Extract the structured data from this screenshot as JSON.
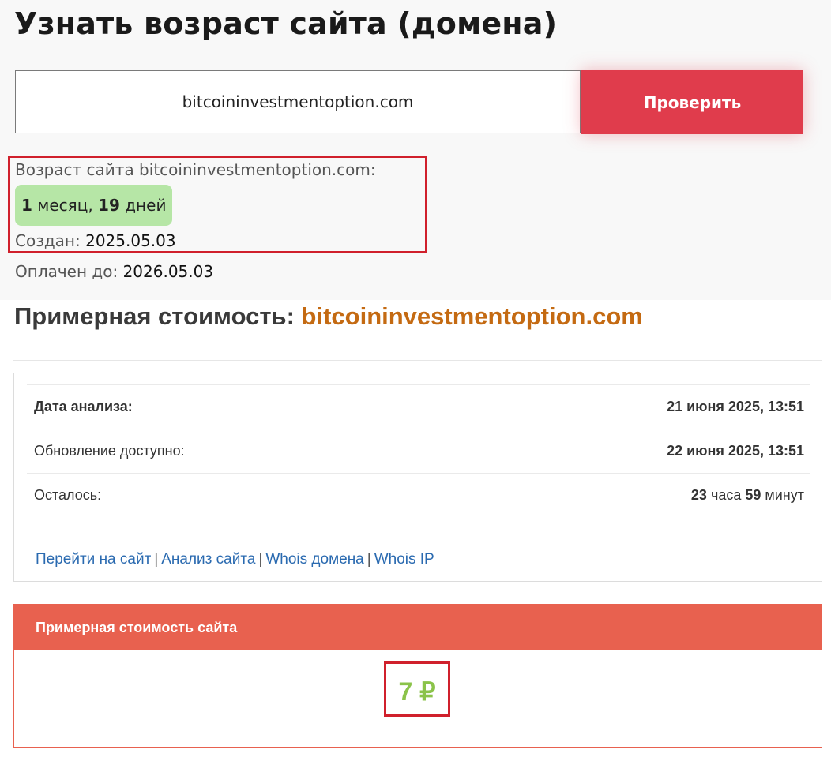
{
  "header": {
    "title": "Узнать возраст сайта (домена)"
  },
  "search": {
    "value": "bitcoininvestmentoption.com",
    "button_label": "Проверить"
  },
  "age": {
    "label": "Возраст сайта bitcoininvestmentoption.com:",
    "badge_num1": "1",
    "badge_text1": " месяц, ",
    "badge_num2": "19",
    "badge_text2": " дней",
    "created_label": "Создан: ",
    "created_value": "2025.05.03",
    "paid_label": "Оплачен до: ",
    "paid_value": "2026.05.03"
  },
  "price_section": {
    "title_prefix": "Примерная стоимость: ",
    "domain": "bitcoininvestmentoption.com"
  },
  "analysis": {
    "rows": [
      {
        "label": "Дата анализа:",
        "value": "21 июня 2025, 13:51"
      },
      {
        "label": "Обновление доступно:",
        "value": "22 июня 2025, 13:51"
      }
    ],
    "remaining_label": "Осталось:",
    "remaining_hours": "23",
    "remaining_hours_unit": " часа ",
    "remaining_minutes": "59",
    "remaining_minutes_unit": " минут"
  },
  "links": {
    "goto_site": "Перейти на сайт",
    "site_analysis": "Анализ сайта",
    "whois_domain": "Whois домена",
    "whois_ip": "Whois IP",
    "separator": "|"
  },
  "value": {
    "header": "Примерная стоимость сайта",
    "amount": "7 ₽"
  },
  "colors": {
    "accent_red": "#e03c4c",
    "panel_header": "#e8614f",
    "age_badge": "#b6e6a6",
    "domain_orange": "#c46a12",
    "value_green": "#8bc34a",
    "link_blue": "#2a6ab0",
    "highlight_border": "#d0202c"
  }
}
